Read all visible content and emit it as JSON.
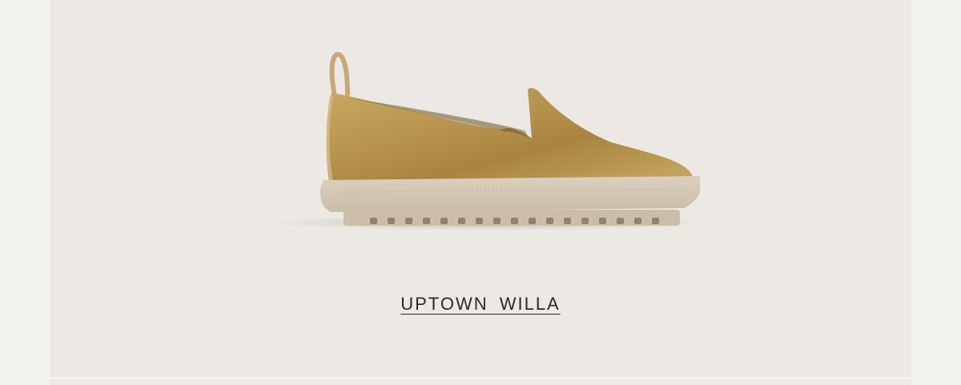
{
  "product": {
    "name": "UPTOWN  WILLA"
  },
  "image": {
    "icon": "gold-slip-on-shoe-image"
  },
  "colors": {
    "background": "#f4f2ef",
    "card": "#ece8e3",
    "shoe_gold": "#b8954f",
    "sole": "#d4c8b6",
    "text": "#2b2a29"
  }
}
